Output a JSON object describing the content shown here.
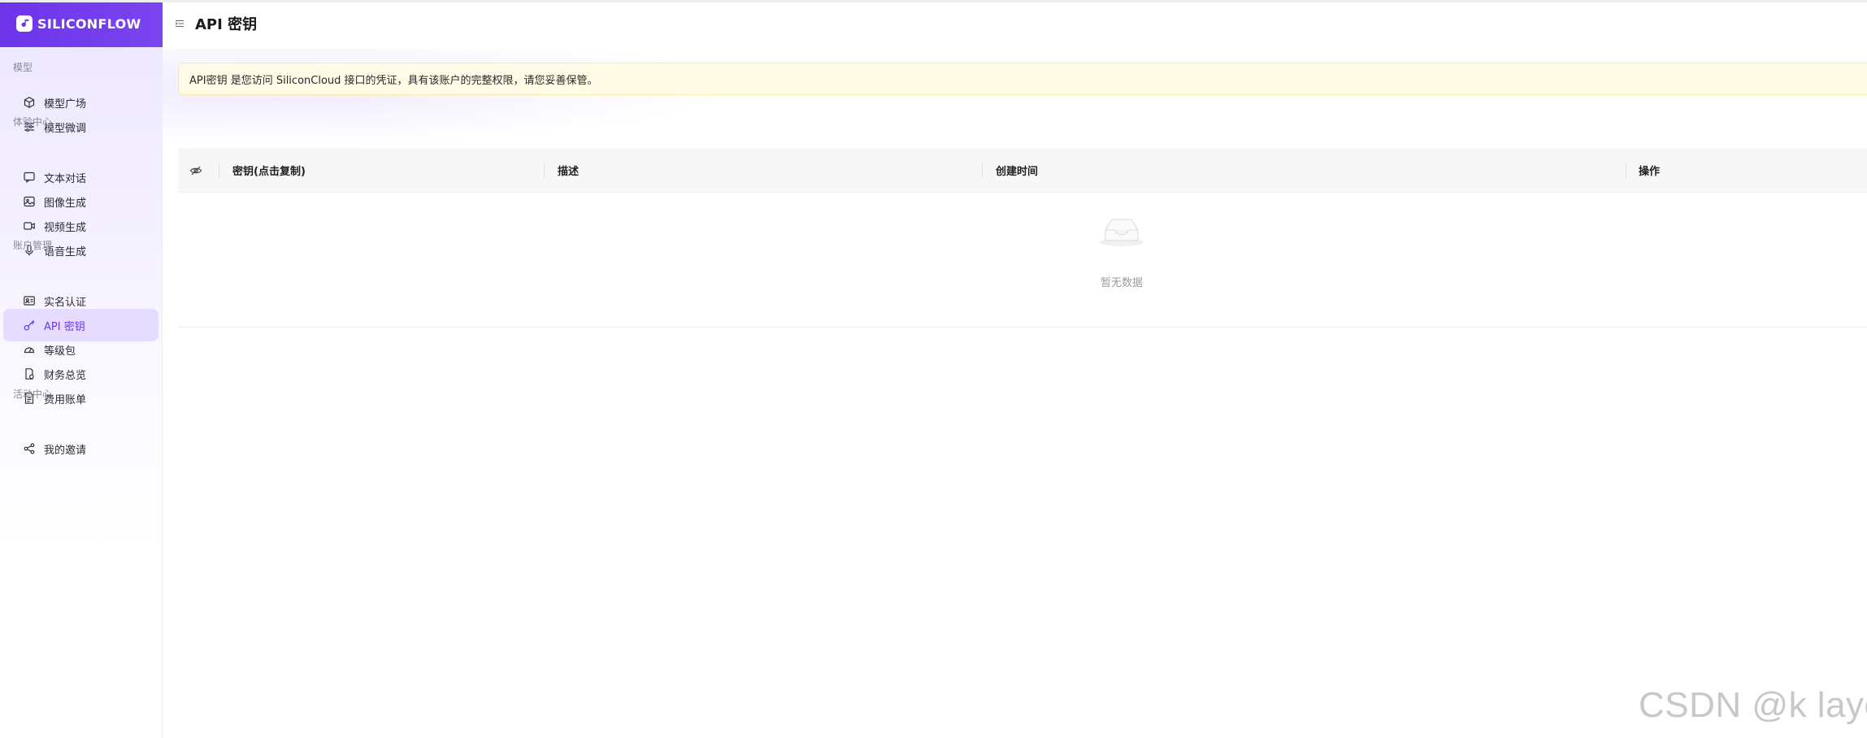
{
  "brand": {
    "name": "SILICONFLOW"
  },
  "sidebar": {
    "groups": [
      {
        "title": "模型",
        "items": [
          {
            "label": "模型广场",
            "icon": "cube-icon"
          },
          {
            "label": "模型微调",
            "icon": "sliders-icon"
          }
        ]
      },
      {
        "title": "体验中心",
        "items": [
          {
            "label": "文本对话",
            "icon": "chat-icon"
          },
          {
            "label": "图像生成",
            "icon": "image-icon"
          },
          {
            "label": "视频生成",
            "icon": "video-icon"
          },
          {
            "label": "语音生成",
            "icon": "mic-icon"
          }
        ]
      },
      {
        "title": "账户管理",
        "items": [
          {
            "label": "实名认证",
            "icon": "id-card-icon"
          },
          {
            "label": "API 密钥",
            "icon": "key-icon",
            "active": true
          },
          {
            "label": "等级包",
            "icon": "gauge-icon"
          },
          {
            "label": "财务总览",
            "icon": "finance-icon"
          },
          {
            "label": "费用账单",
            "icon": "bill-icon"
          }
        ]
      },
      {
        "title": "活动中心",
        "items": [
          {
            "label": "我的邀请",
            "icon": "share-icon"
          }
        ]
      }
    ]
  },
  "header": {
    "title": "API 密钥"
  },
  "alert": {
    "text": "API密钥 是您访问 SiliconCloud 接口的凭证，具有该账户的完整权限，请您妥善保管。"
  },
  "table": {
    "columns": [
      "密钥(点击复制)",
      "描述",
      "创建时间",
      "操作"
    ],
    "rows": [],
    "empty_text": "暂无数据"
  },
  "watermark": "CSDN @k layc",
  "colors": {
    "accent": "#6d35e8",
    "active_bg": "#e6dcff",
    "alert_bg": "#fffbe6"
  }
}
